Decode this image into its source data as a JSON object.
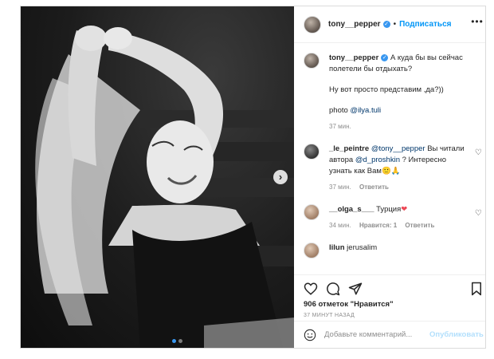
{
  "header": {
    "username": "tony__pepper",
    "separator": "•",
    "follow_label": "Подписаться",
    "more_label": "•••"
  },
  "caption": {
    "username": "tony__pepper",
    "line1": "А куда бы вы сейчас полетели бы отдыхать?",
    "line2": "Ну вот просто представим ,да?))",
    "line3_prefix": "photo ",
    "line3_mention": "@ilya.tuli",
    "time": "37 мин."
  },
  "comments": [
    {
      "username": "_le_peintre",
      "mention1": "@tony__pepper",
      "text1": " Вы читали автора ",
      "mention2": "@d_proshkin",
      "text2": " ? Интересно узнать как Вам🙂🙏",
      "time": "37 мин.",
      "reply_label": "Ответить"
    },
    {
      "username": "__olga_s___",
      "text": " Турция",
      "heart": "❤",
      "time": "34 мин.",
      "likes_label": "Нравится: 1",
      "reply_label": "Ответить"
    },
    {
      "username": "lilun",
      "text": " jerusalim"
    }
  ],
  "actions": {
    "likes_text": "906 отметок \"Нравится\"",
    "time_ago": "37 МИНУТ НАЗАД"
  },
  "add_comment": {
    "placeholder": "Добавьте комментарий...",
    "publish_label": "Опубликовать"
  },
  "media": {
    "next_arrow": "›",
    "slide_count": 2,
    "active_slide": 1
  },
  "colors": {
    "accent": "#0095f6",
    "verified": "#3897f0",
    "heart": "#ed4956",
    "muted": "#8e8e8e"
  }
}
